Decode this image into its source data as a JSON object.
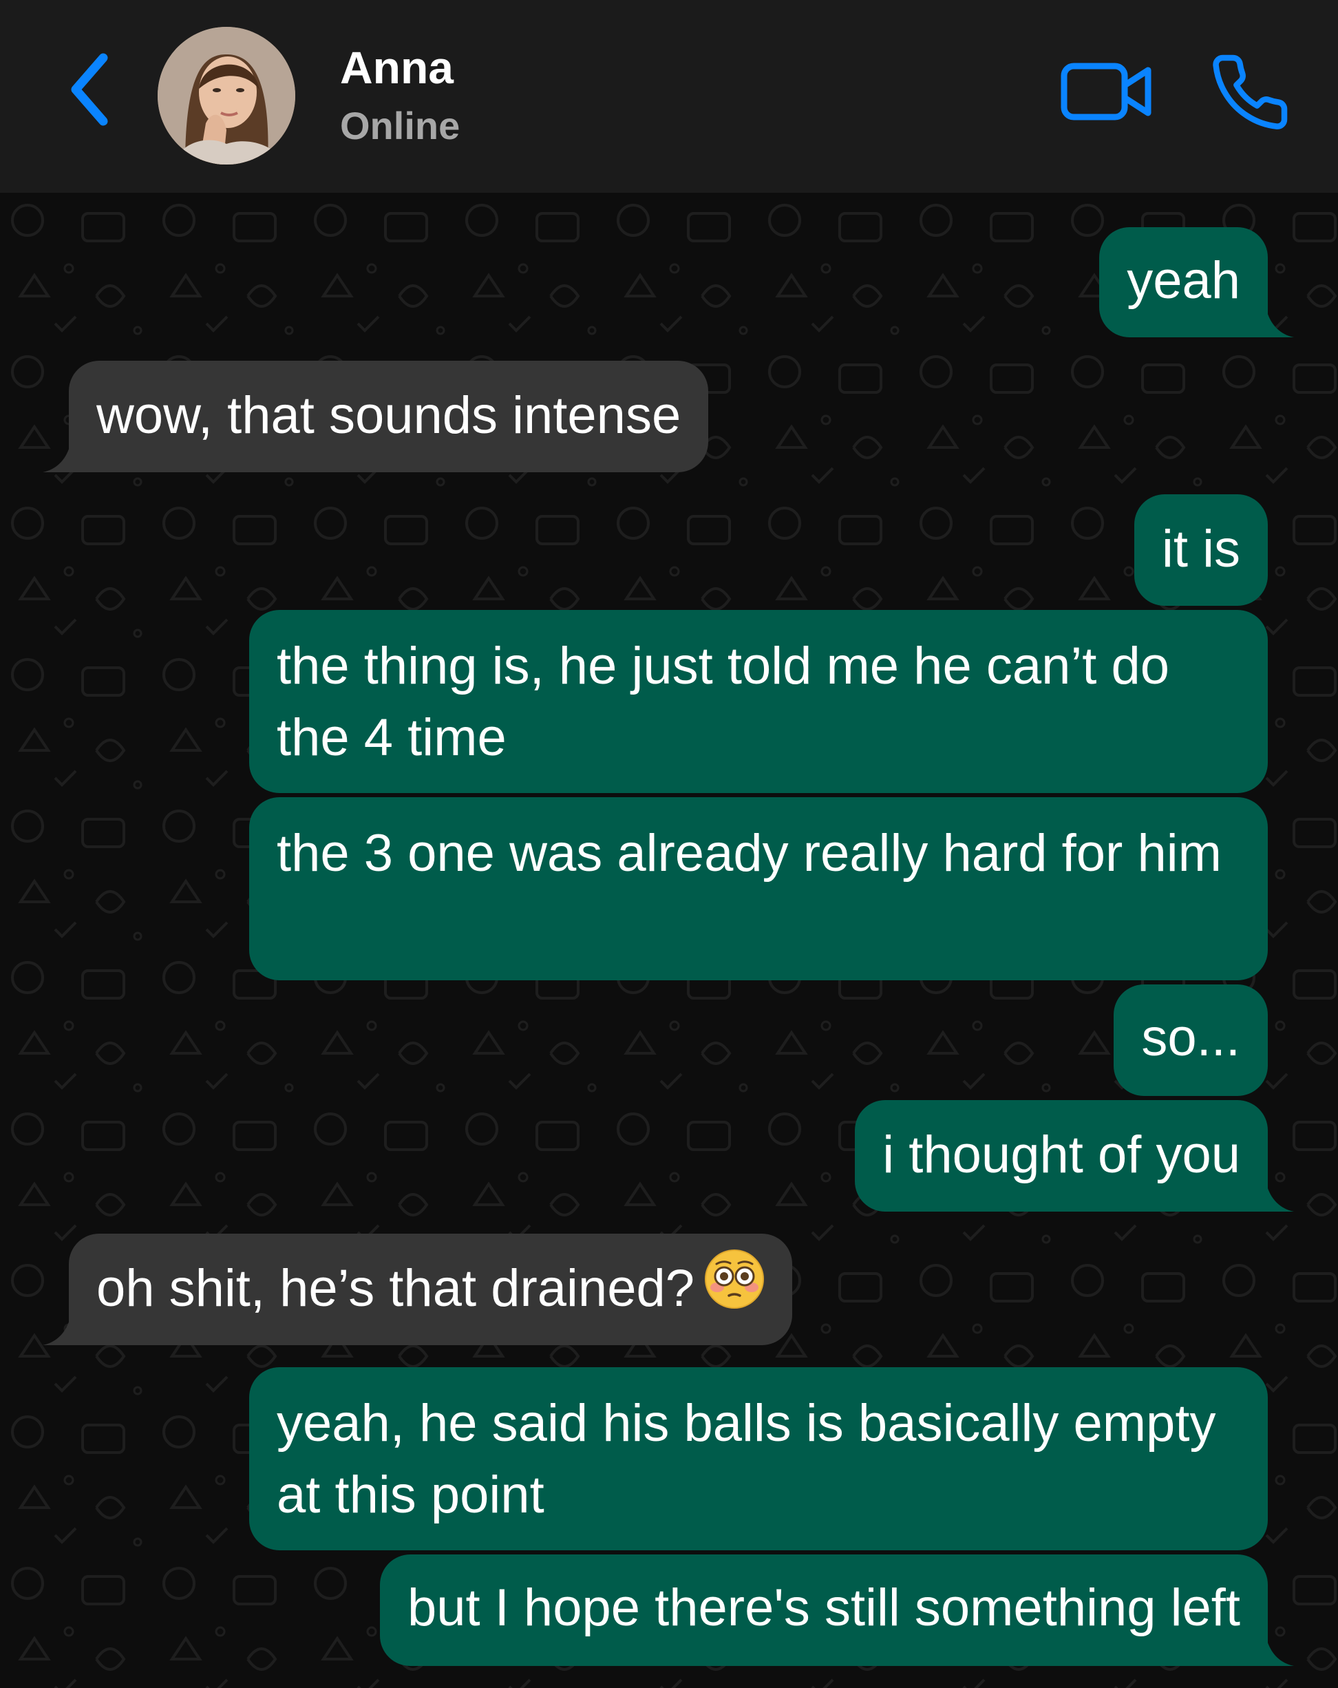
{
  "header": {
    "contact_name": "Anna",
    "status": "Online",
    "accent_color": "#0a84ff"
  },
  "icons": {
    "back": "chevron-left-icon",
    "video": "video-camera-icon",
    "call": "phone-icon",
    "flushed": "flushed-face-emoji"
  },
  "colors": {
    "outgoing_bubble": "#005c4b",
    "incoming_bubble": "#363636",
    "header_background": "#1b1b1b",
    "chat_background": "#0d0d0d"
  },
  "messages": [
    {
      "direction": "outgoing",
      "text": "yeah"
    },
    {
      "direction": "incoming",
      "text": "wow, that sounds intense"
    },
    {
      "direction": "outgoing",
      "text": "it is"
    },
    {
      "direction": "outgoing",
      "text": "the thing is, he just told me he can’t do the 4 time"
    },
    {
      "direction": "outgoing",
      "text": "the 3 one was already really hard for him"
    },
    {
      "direction": "outgoing",
      "text": "so..."
    },
    {
      "direction": "outgoing",
      "text": "i thought of you"
    },
    {
      "direction": "incoming",
      "text": "oh shit, he’s that drained?",
      "emoji": "flushed-face"
    },
    {
      "direction": "outgoing",
      "text": "yeah, he said his balls is basically empty at this point"
    },
    {
      "direction": "outgoing",
      "text": "but I hope there's still something left"
    }
  ]
}
